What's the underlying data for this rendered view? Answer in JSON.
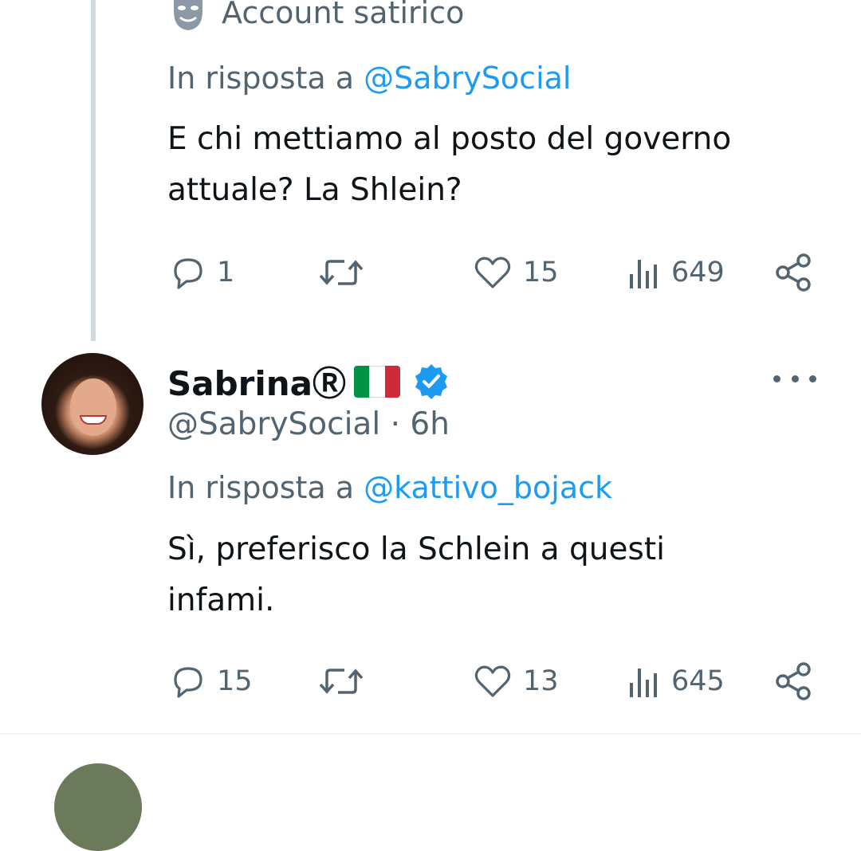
{
  "first_tweet": {
    "label": "Account satirico",
    "reply_prefix": "In risposta a",
    "reply_mention": "@SabrySocial",
    "text_line1": "E chi mettiamo al posto del governo",
    "text_line2": "attuale? La Shlein?",
    "stats": {
      "replies": "1",
      "retweets": "",
      "likes": "15",
      "views": "649"
    }
  },
  "second_tweet": {
    "name": "SabrinaⓇ",
    "handle": "@SabrySocial",
    "separator": "·",
    "time": "6h",
    "reply_prefix": "In risposta a",
    "reply_mention": "@kattivo_bojack",
    "text_line1": "Sì, preferisco la Schlein a questi",
    "text_line2": "infami.",
    "stats": {
      "replies": "15",
      "retweets": "",
      "likes": "13",
      "views": "645"
    }
  },
  "colors": {
    "accent": "#1d9bf0",
    "secondary_text": "#536471",
    "thread_line": "#cfd9de",
    "verified_badge": "#1d9bf0",
    "flag_green": "#009246",
    "flag_white": "#ffffff",
    "flag_red": "#ce2b37"
  },
  "icons": [
    "theater-mask-icon",
    "reply-icon",
    "retweet-icon",
    "like-icon",
    "views-icon",
    "share-icon",
    "verified-badge-icon",
    "italian-flag-icon",
    "more-icon"
  ]
}
